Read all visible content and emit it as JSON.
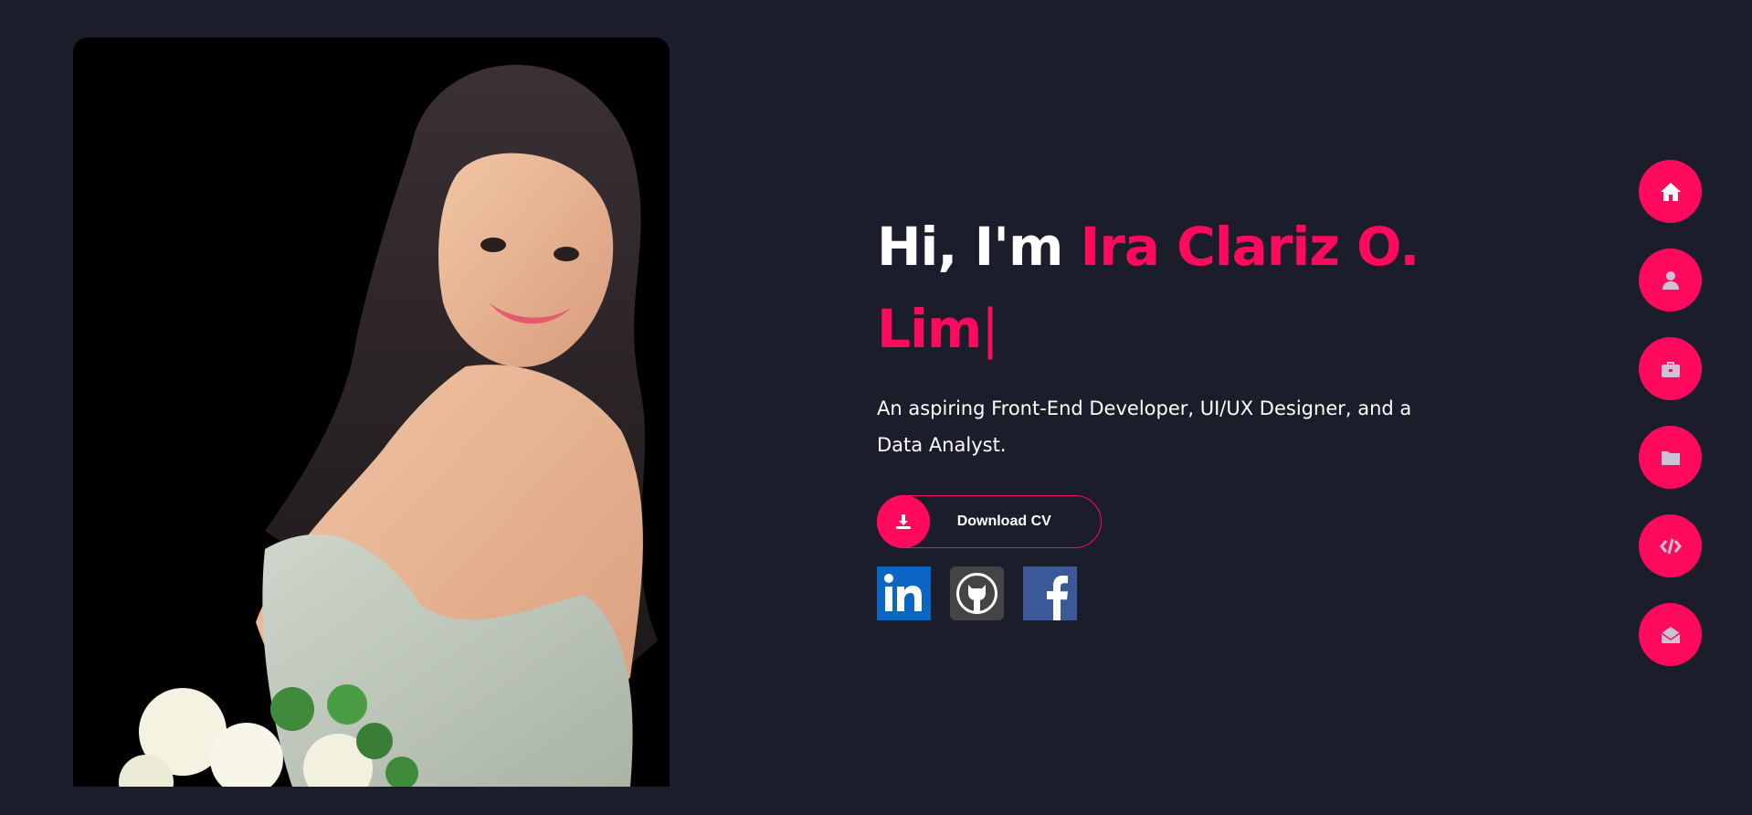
{
  "hero": {
    "greeting": "Hi, I'm ",
    "name": "Ira Clariz O. Lim",
    "cursor": "|",
    "subtitle": "An aspiring Front-End Developer, UI/UX Designer, and a Data Analyst."
  },
  "cv_button": {
    "label": "Download CV",
    "icon": "download-icon"
  },
  "socials": [
    {
      "name": "LinkedIn",
      "icon": "linkedin-icon"
    },
    {
      "name": "GitHub",
      "icon": "github-icon"
    },
    {
      "name": "Facebook",
      "icon": "facebook-icon"
    }
  ],
  "nav": [
    {
      "icon": "home-icon",
      "active": true
    },
    {
      "icon": "user-icon",
      "active": false
    },
    {
      "icon": "briefcase-icon",
      "active": false
    },
    {
      "icon": "folder-icon",
      "active": false
    },
    {
      "icon": "code-icon",
      "active": false
    },
    {
      "icon": "envelope-open-icon",
      "active": false
    }
  ],
  "colors": {
    "background": "#1b1d2b",
    "accent": "#ff0a5c",
    "text": "#ffffff",
    "nav_icon_inactive": "#c8c4d6"
  }
}
